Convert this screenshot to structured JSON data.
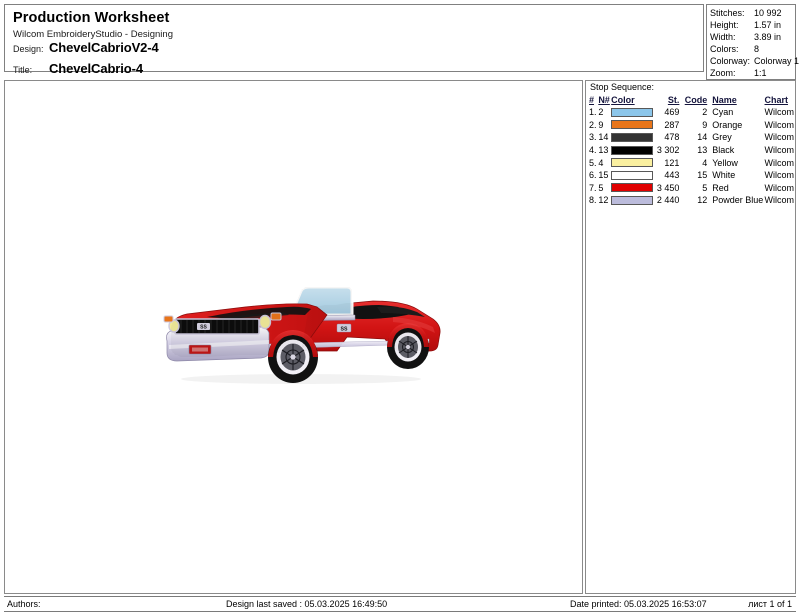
{
  "header": {
    "worksheet_title": "Production Worksheet",
    "app_subtitle": "Wilcom EmbroideryStudio - Designing",
    "design_label": "Design:",
    "design_value": "ChevelCabrioV2-4",
    "title_label": "Title:",
    "title_value": "ChevelCabrio-4"
  },
  "stats": [
    {
      "label": "Stitches:",
      "value": "10 992"
    },
    {
      "label": "Height:",
      "value": "1.57 in"
    },
    {
      "label": "Width:",
      "value": "3.89 in"
    },
    {
      "label": "Colors:",
      "value": "8"
    },
    {
      "label": "Colorway:",
      "value": "Colorway 1"
    },
    {
      "label": "Zoom:",
      "value": "1:1"
    }
  ],
  "stop_sequence": {
    "label": "Stop Sequence:",
    "columns": {
      "index": "#",
      "needle": "N#",
      "color": "Color",
      "stitches": "St.",
      "code": "Code",
      "name": "Name",
      "chart": "Chart"
    },
    "rows": [
      {
        "index": "1.",
        "needle": "2",
        "swatch": "#8cc6ea",
        "stitches": "469",
        "code": "2",
        "name": "Cyan",
        "chart": "Wilcom"
      },
      {
        "index": "2.",
        "needle": "9",
        "swatch": "#e8751a",
        "stitches": "287",
        "code": "9",
        "name": "Orange",
        "chart": "Wilcom"
      },
      {
        "index": "3.",
        "needle": "14",
        "swatch": "#333333",
        "stitches": "478",
        "code": "14",
        "name": "Grey",
        "chart": "Wilcom"
      },
      {
        "index": "4.",
        "needle": "13",
        "swatch": "#000000",
        "stitches": "3 302",
        "code": "13",
        "name": "Black",
        "chart": "Wilcom"
      },
      {
        "index": "5.",
        "needle": "4",
        "swatch": "#faf0a0",
        "stitches": "121",
        "code": "4",
        "name": "Yellow",
        "chart": "Wilcom"
      },
      {
        "index": "6.",
        "needle": "15",
        "swatch": "#ffffff",
        "stitches": "443",
        "code": "15",
        "name": "White",
        "chart": "Wilcom"
      },
      {
        "index": "7.",
        "needle": "5",
        "swatch": "#e00000",
        "stitches": "3 450",
        "code": "5",
        "name": "Red",
        "chart": "Wilcom"
      },
      {
        "index": "8.",
        "needle": "12",
        "swatch": "#bcbcdc",
        "stitches": "2 440",
        "code": "12",
        "name": "Powder Blue",
        "chart": "Wilcom"
      }
    ]
  },
  "design_preview": {
    "subject": "red-chevelle-convertible-embroidery",
    "body_color": "#e01a1a",
    "trim_color": "#c9c6dd",
    "glass_color": "#b9dcef",
    "interior_color": "#111111",
    "headlight_color": "#f2ea9a",
    "signal_color": "#e8751a"
  },
  "footer": {
    "authors": "Authors:",
    "last_saved": "Design last saved : 05.03.2025 16:49:50",
    "date_printed": "Date printed: 05.03.2025 16:53:07",
    "page": "лист 1 of 1"
  }
}
